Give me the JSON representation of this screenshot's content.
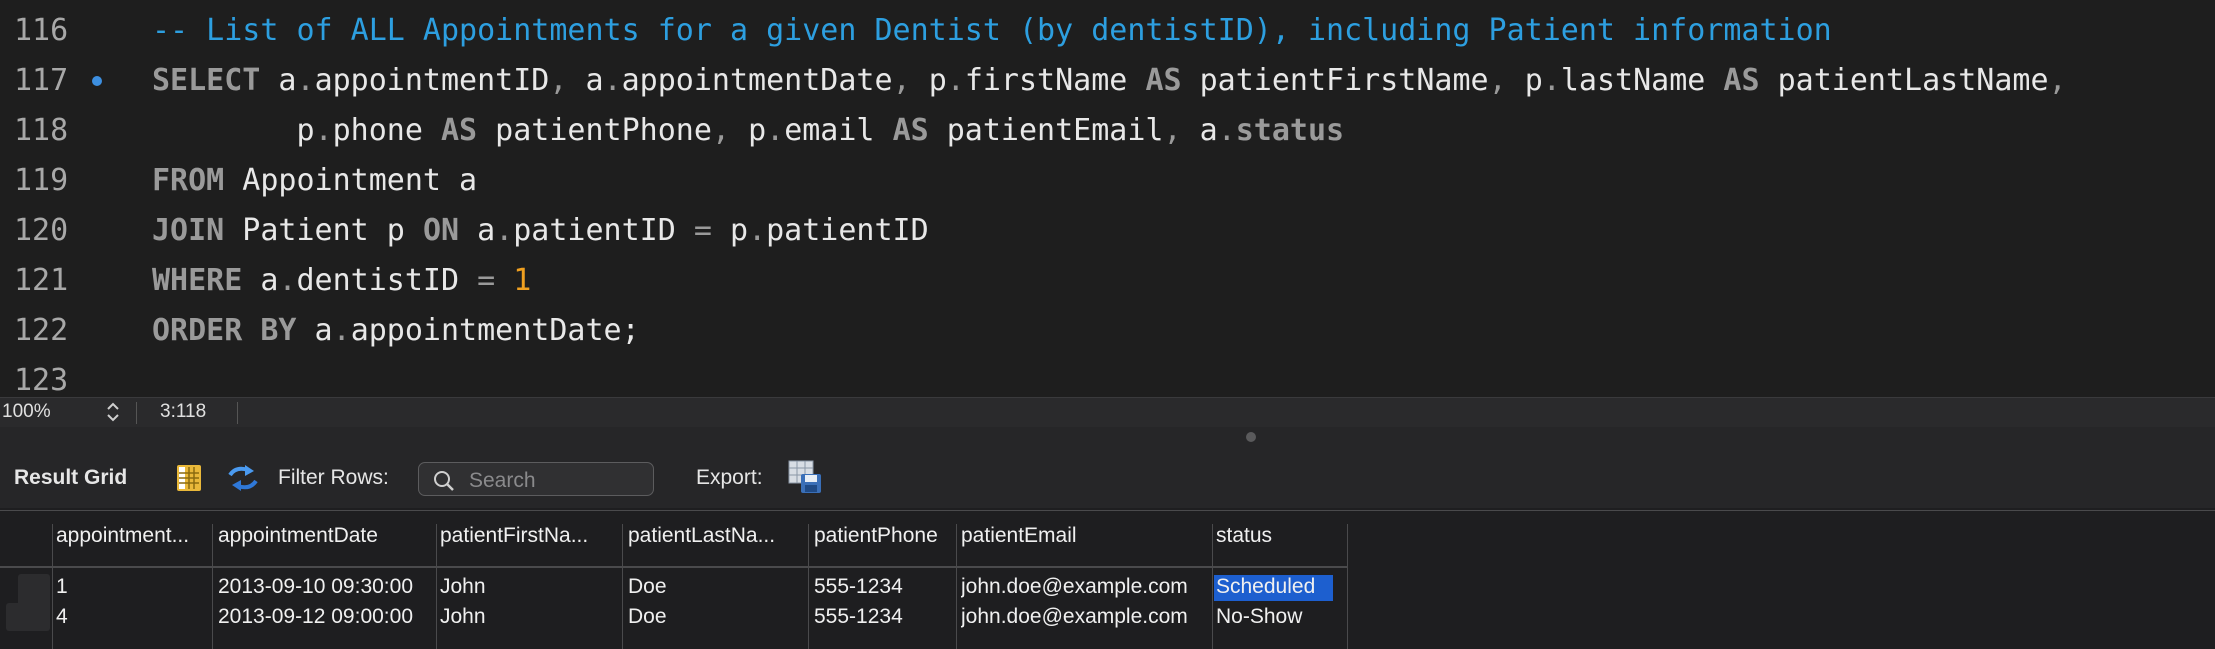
{
  "editor": {
    "lines": [
      {
        "num": "116",
        "marker": false,
        "tokens": [
          {
            "t": "-- List of ALL Appointments for a given Dentist (by dentistID), including Patient information",
            "c": "cm"
          }
        ]
      },
      {
        "num": "117",
        "marker": true,
        "tokens": [
          {
            "t": "SELECT",
            "c": "kw"
          },
          {
            "t": " a"
          },
          {
            "t": ".",
            "c": "op"
          },
          {
            "t": "appointmentID"
          },
          {
            "t": ", ",
            "c": "op"
          },
          {
            "t": "a"
          },
          {
            "t": ".",
            "c": "op"
          },
          {
            "t": "appointmentDate"
          },
          {
            "t": ", ",
            "c": "op"
          },
          {
            "t": "p"
          },
          {
            "t": ".",
            "c": "op"
          },
          {
            "t": "firstName "
          },
          {
            "t": "AS",
            "c": "kw"
          },
          {
            "t": " patientFirstName"
          },
          {
            "t": ", ",
            "c": "op"
          },
          {
            "t": "p"
          },
          {
            "t": ".",
            "c": "op"
          },
          {
            "t": "lastName "
          },
          {
            "t": "AS",
            "c": "kw"
          },
          {
            "t": " patientLastName"
          },
          {
            "t": ",",
            "c": "op"
          }
        ]
      },
      {
        "num": "118",
        "marker": false,
        "tokens": [
          {
            "t": "        p"
          },
          {
            "t": ".",
            "c": "op"
          },
          {
            "t": "phone "
          },
          {
            "t": "AS",
            "c": "kw"
          },
          {
            "t": " patientPhone"
          },
          {
            "t": ", ",
            "c": "op"
          },
          {
            "t": "p"
          },
          {
            "t": ".",
            "c": "op"
          },
          {
            "t": "email "
          },
          {
            "t": "AS",
            "c": "kw"
          },
          {
            "t": " patientEmail"
          },
          {
            "t": ", ",
            "c": "op"
          },
          {
            "t": "a"
          },
          {
            "t": ".",
            "c": "op"
          },
          {
            "t": "status",
            "c": "kw"
          }
        ]
      },
      {
        "num": "119",
        "marker": false,
        "tokens": [
          {
            "t": "FROM",
            "c": "kw"
          },
          {
            "t": " Appointment a"
          }
        ]
      },
      {
        "num": "120",
        "marker": false,
        "tokens": [
          {
            "t": "JOIN",
            "c": "kw"
          },
          {
            "t": " Patient p "
          },
          {
            "t": "ON",
            "c": "kw"
          },
          {
            "t": " a"
          },
          {
            "t": ".",
            "c": "op"
          },
          {
            "t": "patientID "
          },
          {
            "t": "=",
            "c": "op"
          },
          {
            "t": " p"
          },
          {
            "t": ".",
            "c": "op"
          },
          {
            "t": "patientID"
          }
        ]
      },
      {
        "num": "121",
        "marker": false,
        "tokens": [
          {
            "t": "WHERE",
            "c": "kw"
          },
          {
            "t": " a"
          },
          {
            "t": ".",
            "c": "op"
          },
          {
            "t": "dentistID "
          },
          {
            "t": "=",
            "c": "op"
          },
          {
            "t": " "
          },
          {
            "t": "1",
            "c": "num"
          }
        ]
      },
      {
        "num": "122",
        "marker": false,
        "tokens": [
          {
            "t": "ORDER BY",
            "c": "kw"
          },
          {
            "t": " a"
          },
          {
            "t": ".",
            "c": "op"
          },
          {
            "t": "appointmentDate;"
          }
        ]
      },
      {
        "num": "123",
        "marker": false,
        "tokens": []
      }
    ]
  },
  "status_bar": {
    "zoom": "100%",
    "cursor": "3:118"
  },
  "toolbar": {
    "title": "Result Grid",
    "filter_label": "Filter Rows:",
    "search_placeholder": "Search",
    "export_label": "Export:",
    "icons": [
      "grid-toggle-icon",
      "refresh-icon",
      "search-icon",
      "export-icon"
    ]
  },
  "grid": {
    "columns": [
      "appointment...",
      "appointmentDate",
      "patientFirstNa...",
      "patientLastNa...",
      "patientPhone",
      "patientEmail",
      "status"
    ],
    "rows": [
      [
        "1",
        "2013-09-10 09:30:00",
        "John",
        "Doe",
        "555-1234",
        "john.doe@example.com",
        "Scheduled"
      ],
      [
        "4",
        "2013-09-12 09:00:00",
        "John",
        "Doe",
        "555-1234",
        "john.doe@example.com",
        "No-Show"
      ]
    ],
    "selected_cell": {
      "row": 0,
      "col": 6
    }
  },
  "colors": {
    "keyword": "#9a9a9a",
    "comment": "#2d9fe0",
    "number": "#f0a020",
    "selection": "#1d5fcf"
  }
}
